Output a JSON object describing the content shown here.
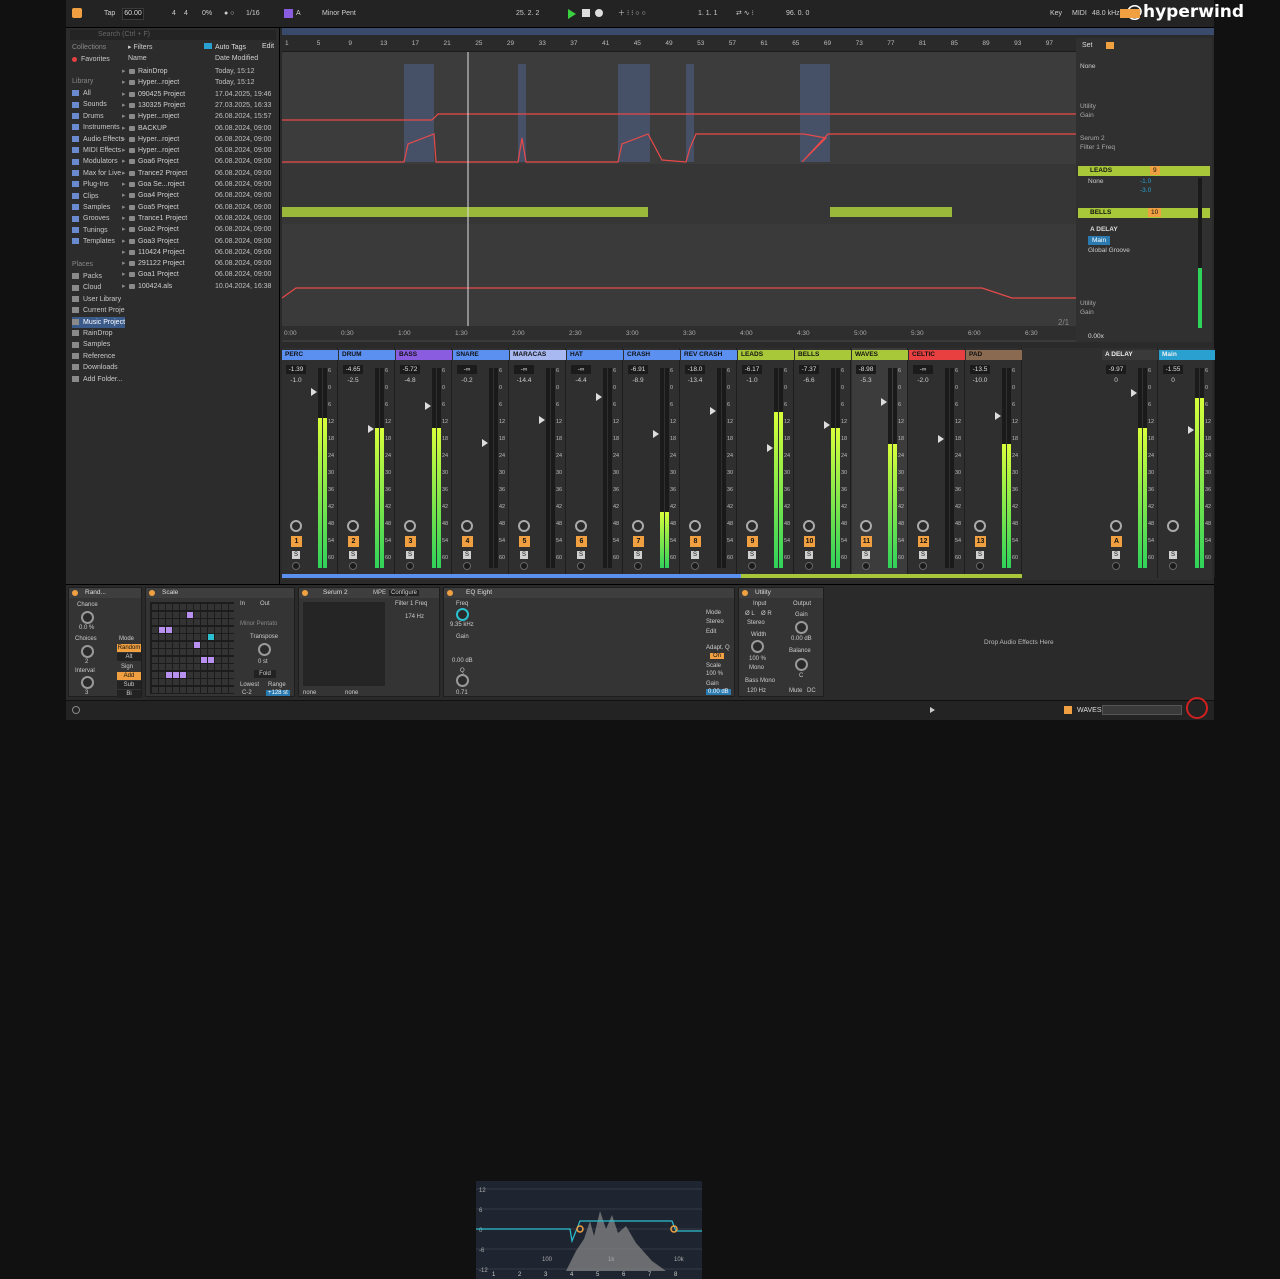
{
  "handle": "@hyperwind",
  "transport": {
    "tap": "Tap",
    "tempo": "60.00",
    "signature_num": "4",
    "signature_den": "4",
    "groove": "0%",
    "quantize": "1/16",
    "key_root": "A",
    "scale": "Minor Pent",
    "position": "25.   2.   2",
    "loop_start": "1.   1.   1",
    "loop_len": "96.   0.   0",
    "key_label": "Key",
    "midi_label": "MIDI",
    "sample_rate": "48.0 kHz"
  },
  "browser": {
    "search_placeholder": "Search (Ctrl + F)",
    "collections_head": "Collections",
    "favorites": "Favorites",
    "filters": "Filters",
    "auto_tags": "Auto Tags",
    "edit": "Edit",
    "col_name": "Name",
    "col_date": "Date Modified",
    "library_head": "Library",
    "library": [
      "All",
      "Sounds",
      "Drums",
      "Instruments",
      "Audio Effects",
      "MIDI Effects",
      "Modulators",
      "Max for Live",
      "Plug-Ins",
      "Clips",
      "Samples",
      "Grooves",
      "Tunings",
      "Templates"
    ],
    "places_head": "Places",
    "places": [
      "Packs",
      "Cloud",
      "User Library",
      "Current Proje",
      "Music Project",
      "RainDrop",
      "Samples",
      "Reference",
      "Downloads",
      "Add Folder..."
    ],
    "files": [
      {
        "name": "RainDrop",
        "date": "Today, 15:12"
      },
      {
        "name": "Hyper...roject",
        "date": "Today, 15:12"
      },
      {
        "name": "090425 Project",
        "date": "17.04.2025, 19:46"
      },
      {
        "name": "130325 Project",
        "date": "27.03.2025, 16:33"
      },
      {
        "name": "Hyper...roject",
        "date": "26.08.2024, 15:57"
      },
      {
        "name": "BACKUP",
        "date": "06.08.2024, 09:00"
      },
      {
        "name": "Hyper...roject",
        "date": "06.08.2024, 09:00"
      },
      {
        "name": "Hyper...roject",
        "date": "06.08.2024, 09:00"
      },
      {
        "name": "Goa6 Project",
        "date": "06.08.2024, 09:00"
      },
      {
        "name": "Trance2 Project",
        "date": "06.08.2024, 09:00"
      },
      {
        "name": "Goa Se...roject",
        "date": "06.08.2024, 09:00"
      },
      {
        "name": "Goa4 Project",
        "date": "06.08.2024, 09:00"
      },
      {
        "name": "Goa5 Project",
        "date": "06.08.2024, 09:00"
      },
      {
        "name": "Trance1 Project",
        "date": "06.08.2024, 09:00"
      },
      {
        "name": "Goa2 Project",
        "date": "06.08.2024, 09:00"
      },
      {
        "name": "Goa3 Project",
        "date": "06.08.2024, 09:00"
      },
      {
        "name": "110424 Project",
        "date": "06.08.2024, 09:00"
      },
      {
        "name": "291122 Project",
        "date": "06.08.2024, 09:00"
      },
      {
        "name": "Goa1 Project",
        "date": "06.08.2024, 09:00"
      },
      {
        "name": "100424.als",
        "date": "10.04.2024, 16:38"
      }
    ]
  },
  "ruler": [
    "1",
    "5",
    "9",
    "13",
    "17",
    "21",
    "25",
    "29",
    "33",
    "37",
    "41",
    "45",
    "49",
    "53",
    "57",
    "61",
    "65",
    "69",
    "73",
    "77",
    "81",
    "85",
    "89",
    "93",
    "97"
  ],
  "timeline": [
    "0:00",
    "0:30",
    "1:00",
    "1:30",
    "2:00",
    "2:30",
    "3:00",
    "3:30",
    "4:00",
    "4:30",
    "5:00",
    "5:30",
    "6:00",
    "6:30"
  ],
  "zoom": "2/1",
  "tracks": {
    "set": "Set",
    "none1": "None",
    "utility": "Utility",
    "gain": "Gain",
    "serum": "Serum 2",
    "filter": "Filter 1 Freq",
    "leads": "LEADS",
    "leads_num": "9",
    "none2": "None",
    "leads_vol": "-1.0",
    "leads_pk": "-3.0",
    "bells": "BELLS",
    "bells_num": "10",
    "adelay": "A DELAY",
    "main": "Main",
    "global": "Global Groove",
    "utility2": "Utility",
    "gain2": "Gain",
    "zero": "0.00x"
  },
  "mixer": [
    {
      "name": "PERC",
      "color": "#5b8ff0",
      "vol": "-1.39",
      "pk": "-1.0",
      "num": "1",
      "lvl": 0.75
    },
    {
      "name": "DRUM",
      "color": "#5b8ff0",
      "vol": "-4.65",
      "pk": "-2.5",
      "num": "2",
      "lvl": 0.7
    },
    {
      "name": "BASS",
      "color": "#8a5ce0",
      "vol": "-5.72",
      "pk": "-4.8",
      "num": "3",
      "lvl": 0.7
    },
    {
      "name": "SNARE",
      "color": "#5b8ff0",
      "vol": "-∞",
      "pk": "-0.2",
      "num": "4",
      "lvl": 0
    },
    {
      "name": "MARACAS",
      "color": "#a8b8f0",
      "vol": "-∞",
      "pk": "-14.4",
      "num": "5",
      "lvl": 0
    },
    {
      "name": "HAT",
      "color": "#5b8ff0",
      "vol": "-∞",
      "pk": "-4.4",
      "num": "6",
      "lvl": 0
    },
    {
      "name": "CRASH",
      "color": "#5b8ff0",
      "vol": "-6.91",
      "pk": "-8.9",
      "num": "7",
      "lvl": 0.28
    },
    {
      "name": "REV CRASH",
      "color": "#5b8ff0",
      "vol": "-18.0",
      "pk": "-13.4",
      "num": "8",
      "lvl": 0
    },
    {
      "name": "LEADS",
      "color": "#a8c83a",
      "vol": "-6.17",
      "pk": "-1.0",
      "num": "9",
      "lvl": 0.78
    },
    {
      "name": "BELLS",
      "color": "#a8c83a",
      "vol": "-7.37",
      "pk": "-6.6",
      "num": "10",
      "lvl": 0.7
    },
    {
      "name": "WAVES",
      "color": "#a8c83a",
      "vol": "-8.98",
      "pk": "-5.3",
      "num": "11",
      "lvl": 0.62
    },
    {
      "name": "CELTIC",
      "color": "#e84040",
      "vol": "-∞",
      "pk": "-2.0",
      "num": "12",
      "lvl": 0
    },
    {
      "name": "PAD",
      "color": "#8a6a50",
      "vol": "-13.5",
      "pk": "-10.0",
      "num": "13",
      "lvl": 0.62
    }
  ],
  "returns": [
    {
      "name": "A DELAY",
      "color": "#3a3a3a",
      "vol": "-9.97",
      "pk": "0",
      "num": "A",
      "lvl": 0.7
    },
    {
      "name": "Main",
      "color": "#2aa0d0",
      "vol": "-1.55",
      "pk": "0",
      "num": "",
      "lvl": 0.85
    }
  ],
  "meter_scale": [
    "6",
    "0",
    "6",
    "12",
    "18",
    "24",
    "30",
    "36",
    "42",
    "48",
    "54",
    "60"
  ],
  "devices": {
    "rand": "Rand...",
    "chance": "Chance",
    "chance_val": "0.0 %",
    "choices": "Choices",
    "choices_val": "2",
    "interval": "Interval",
    "interval_val": "3",
    "mode": "Mode",
    "random": "Random",
    "alt": "Alt",
    "sign": "Sign",
    "add": "Add",
    "sub": "Sub",
    "bi": "Bi",
    "scale": "Scale",
    "in": "In",
    "out": "Out",
    "scale_name": "Minor Pentato",
    "transpose": "Transpose",
    "transpose_val": "0 st",
    "fold": "Fold",
    "lowest": "Lowest",
    "range": "Range",
    "lowest_val": "C-2",
    "range_val": "+128 st",
    "serum": "Serum 2",
    "mpe": "MPE",
    "configure": "Configure",
    "filter_freq": "Filter 1 Freq",
    "filter_val": "174 Hz",
    "none1": "none",
    "none2": "none",
    "eq": "EQ Eight",
    "freq": "Freq",
    "freq_val": "9.35 kHz",
    "eq_gain": "Gain",
    "eq_gain_val": "0.00 dB",
    "q": "Q",
    "q_val": "0.71",
    "eq_mode": "Mode",
    "stereo": "Stereo",
    "edit": "Edit",
    "adapt": "Adapt. Q",
    "on": "On",
    "eq_scale": "Scale",
    "eq_scale_val": "100 %",
    "eq_out": "Gain",
    "eq_out_val": "0.00 dB",
    "grid": [
      "12",
      "6",
      "0",
      "-6",
      "-12"
    ],
    "freqs": [
      "100",
      "1k",
      "10k"
    ],
    "bands": [
      "1",
      "2",
      "3",
      "4",
      "5",
      "6",
      "7",
      "8"
    ],
    "utility": "Utility",
    "input": "Input",
    "output": "Output",
    "l": "Ø L",
    "r": "Ø R",
    "ustereo": "Stereo",
    "width": "Width",
    "width_val": "100 %",
    "mono": "Mono",
    "bass_mono": "Bass Mono",
    "bass_freq": "120 Hz",
    "ugain": "Gain",
    "ugain_val": "0.00 dB",
    "balance": "Balance",
    "balance_val": "C",
    "mute": "Mute",
    "dc": "DC",
    "drop": "Drop Audio Effects Here"
  },
  "status": {
    "track": "WAVES"
  }
}
